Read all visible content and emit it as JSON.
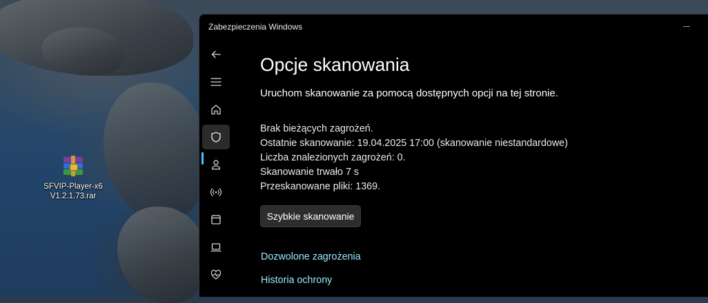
{
  "desktop": {
    "icon_label_line1": "SFVIP-Player-x6",
    "icon_label_line2": "V1.2.1.73.rar",
    "icon": "winrar-archive-icon"
  },
  "window": {
    "title": "Zabezpieczenia Windows",
    "nav": [
      {
        "icon": "back-arrow-icon"
      },
      {
        "icon": "hamburger-menu-icon"
      },
      {
        "icon": "home-icon"
      },
      {
        "icon": "shield-icon",
        "active": true
      },
      {
        "icon": "account-person-icon"
      },
      {
        "icon": "network-wireless-icon"
      },
      {
        "icon": "app-browser-window-icon"
      },
      {
        "icon": "laptop-device-icon"
      },
      {
        "icon": "heart-health-icon"
      }
    ]
  },
  "page": {
    "title": "Opcje skanowania",
    "subtitle": "Uruchom skanowanie za pomocą dostępnych opcji na tej stronie.",
    "status": "Brak bieżących zagrożeń.",
    "last_scan": "Ostatnie skanowanie: 19.04.2025 17:00 (skanowanie niestandardowe)",
    "threats_found": "Liczba znalezionych zagrożeń: 0.",
    "scan_duration": "Skanowanie trwało 7 s",
    "files_scanned": "Przeskanowane pliki: 1369.",
    "quick_scan_label": "Szybkie skanowanie",
    "allowed_threats_link": "Dozwolone zagrożenia",
    "protection_history_link": "Historia ochrony"
  },
  "colors": {
    "accent": "#4cc2ff",
    "link": "#99ebff",
    "window_bg": "#000000",
    "button_bg": "#2d2d2d"
  }
}
